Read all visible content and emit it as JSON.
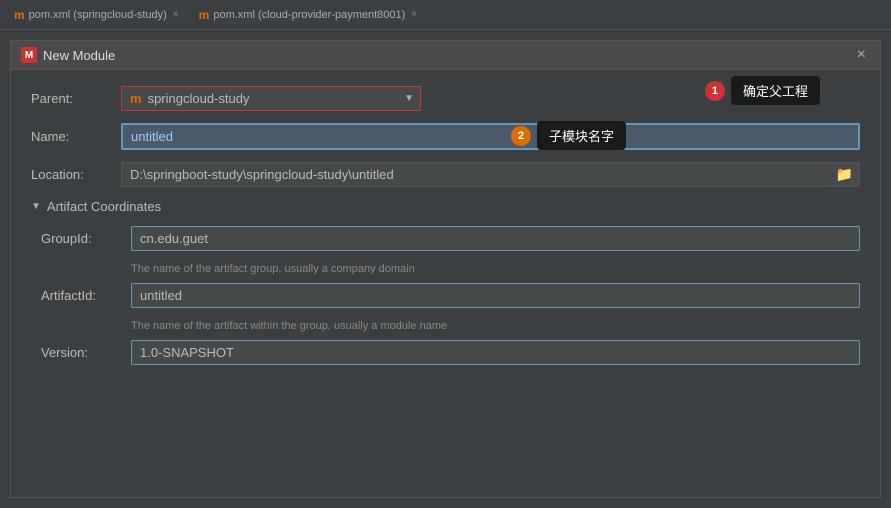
{
  "tabs": [
    {
      "label": "pom.xml (springcloud-study)",
      "icon": "m"
    },
    {
      "label": "pom.xml (cloud-provider-payment8001)",
      "icon": "m"
    }
  ],
  "dialog": {
    "title": "New Module",
    "icon_label": "M",
    "close_label": "×",
    "fields": {
      "parent_label": "Parent:",
      "parent_value": "springcloud-study",
      "parent_icon": "m",
      "name_label": "Name:",
      "name_value": "untitled",
      "location_label": "Location:",
      "location_value": "D:\\springboot-study\\springcloud-study\\untitled"
    },
    "artifact_section": {
      "header": "Artifact Coordinates",
      "groupid_label": "GroupId:",
      "groupid_value": "cn.edu.guet",
      "groupid_help": "The name of the artifact group, usually a company domain",
      "artifactid_label": "ArtifactId:",
      "artifactid_value": "untitled",
      "artifactid_help": "The name of the artifact within the group, usually a module name",
      "version_label": "Version:",
      "version_value": "1.0-SNAPSHOT"
    },
    "annotations": [
      {
        "number": "1",
        "color": "red",
        "text": "确定父工程"
      },
      {
        "number": "2",
        "color": "orange",
        "text": "子模块名字"
      }
    ]
  }
}
